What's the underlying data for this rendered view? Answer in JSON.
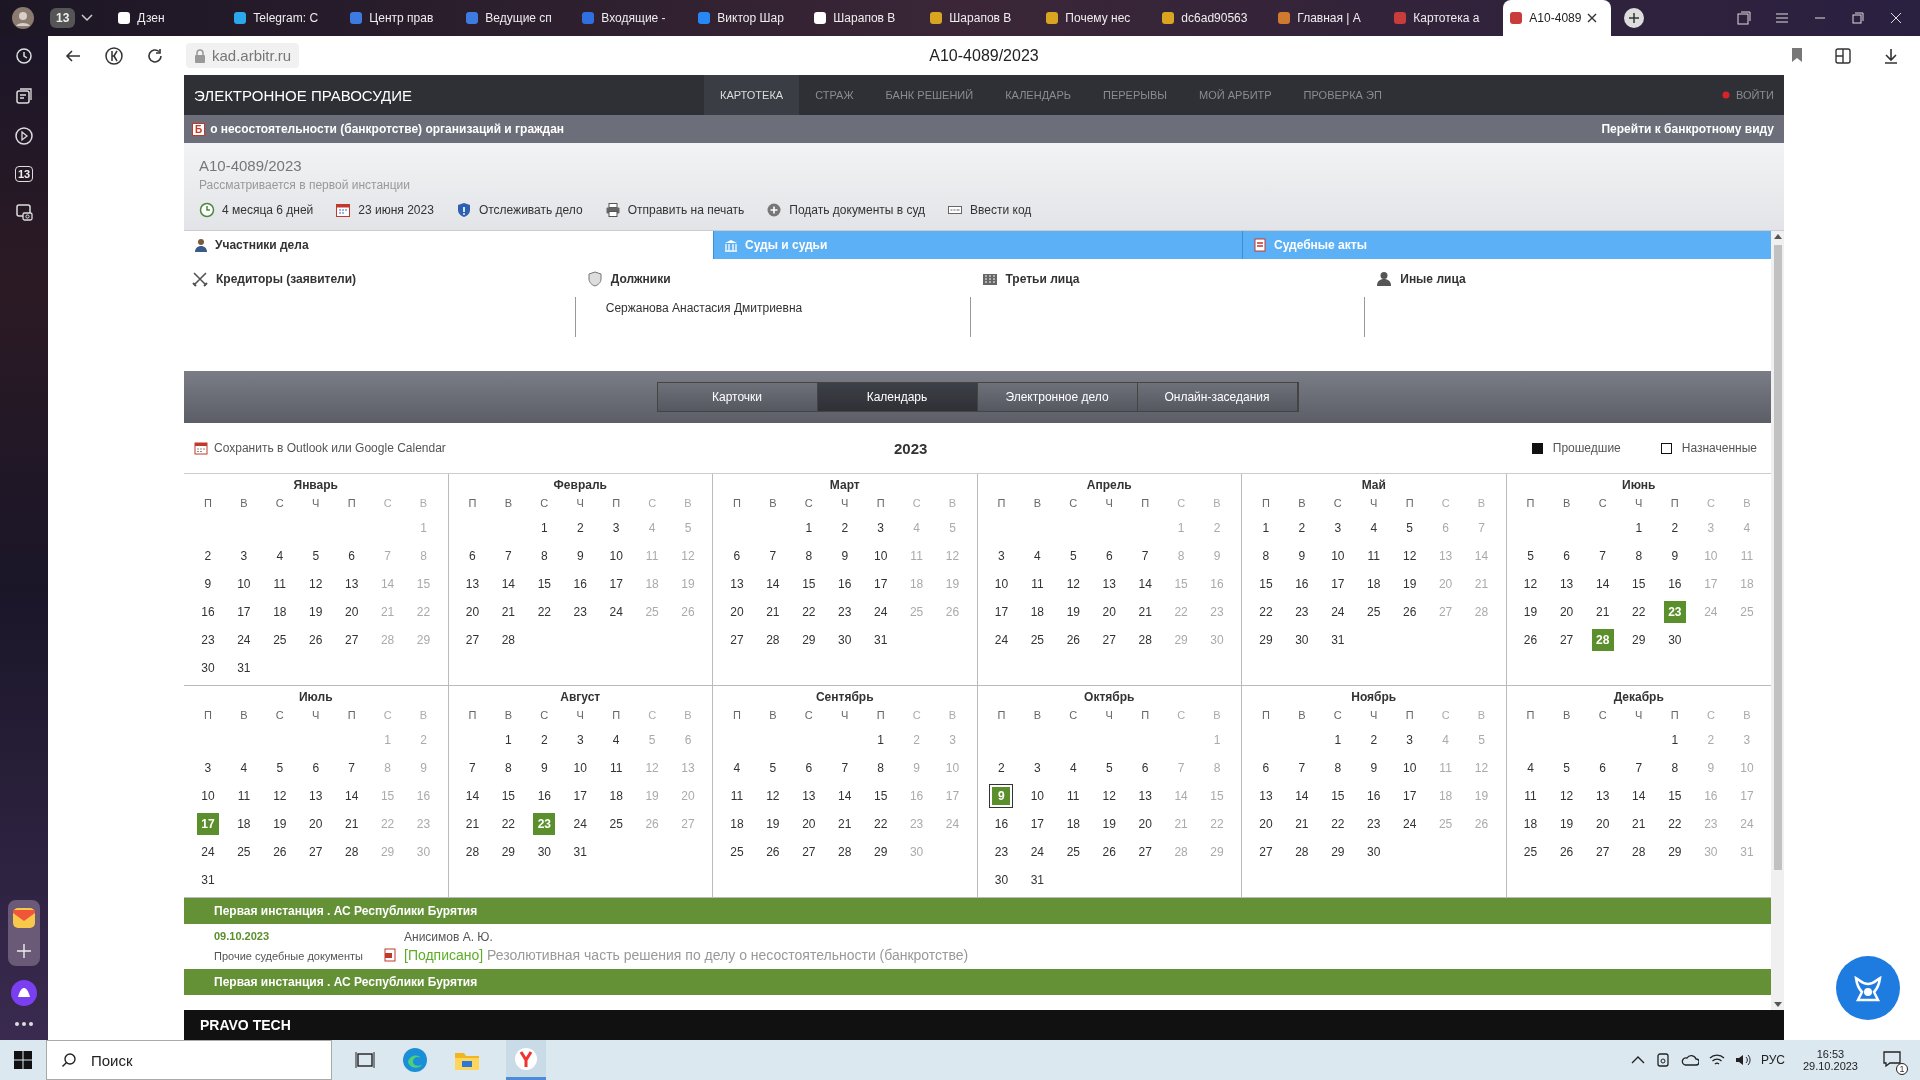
{
  "browser": {
    "tab_count": "13",
    "tabs": [
      {
        "title": "Дзен",
        "selected": false
      },
      {
        "title": "Telegram: С",
        "selected": false
      },
      {
        "title": "Центр прав",
        "selected": false
      },
      {
        "title": "Ведущие сп",
        "selected": false
      },
      {
        "title": "Входящие -",
        "selected": false
      },
      {
        "title": "Виктор Шар",
        "selected": false
      },
      {
        "title": "Шарапов В",
        "selected": false
      },
      {
        "title": "Шарапов В",
        "selected": false
      },
      {
        "title": "Почему нес",
        "selected": false
      },
      {
        "title": "dc6ad90563",
        "selected": false
      },
      {
        "title": "Главная | А",
        "selected": false
      },
      {
        "title": "Картотека а",
        "selected": false
      },
      {
        "title": "A10-4089",
        "selected": true
      }
    ],
    "address": "kad.arbitr.ru",
    "page_title": "A10-4089/2023",
    "sidebar_badge": "13"
  },
  "site": {
    "title": "ЭЛЕКТРОННОЕ ПРАВОСУДИЕ",
    "nav": [
      {
        "label": "КАРТОТЕКА",
        "selected": true
      },
      {
        "label": "СТРАЖ",
        "selected": false
      },
      {
        "label": "БАНК РЕШЕНИЙ",
        "selected": false
      },
      {
        "label": "КАЛЕНДАРЬ",
        "selected": false
      },
      {
        "label": "ПЕРЕРЫВЫ",
        "selected": false
      },
      {
        "label": "МОЙ АРБИТР",
        "selected": false
      },
      {
        "label": "ПРОВЕРКА ЭП",
        "selected": false
      }
    ],
    "login": "ВОЙТИ"
  },
  "bankruptcy_bar": {
    "badge": "Б",
    "text": "о несостоятельности (банкротстве) организаций и граждан",
    "link": "Перейти к банкротному виду"
  },
  "case": {
    "number": "А10-4089/2023",
    "status": "Рассматривается в первой инстанции",
    "info": [
      "4 месяца 6 дней",
      "23 июня 2023",
      "Отслеживать дело",
      "Отправить на печать",
      "Подать документы в суд",
      "Ввести код"
    ]
  },
  "case_tabs": [
    {
      "label": "Участники дела",
      "selected": true
    },
    {
      "label": "Суды и судьи",
      "selected": false
    },
    {
      "label": "Судебные акты",
      "selected": false
    }
  ],
  "participants": [
    {
      "heading": "Кредиторы (заявители)"
    },
    {
      "heading": "Должники",
      "names": [
        "Сержанова Анастасия Дмитриевна"
      ]
    },
    {
      "heading": "Третьи лица"
    },
    {
      "heading": "Иные лица"
    }
  ],
  "view_tabs": [
    {
      "label": "Карточки",
      "selected": false
    },
    {
      "label": "Календарь",
      "selected": true
    },
    {
      "label": "Электронное дело",
      "selected": false
    },
    {
      "label": "Онлайн-заседания",
      "selected": false
    }
  ],
  "calendar": {
    "save_link": "Сохранить в Outlook или Google Calendar",
    "year": "2023",
    "legend": [
      {
        "label": "Прошедшие",
        "kind": "past"
      },
      {
        "label": "Назначенные",
        "kind": "scheduled"
      }
    ],
    "months": [
      {
        "name": "Январь",
        "weekdays": [
          "П",
          "В",
          "С",
          "Ч",
          "П",
          "С",
          "В"
        ],
        "weeks": [
          [
            "1"
          ],
          [
            "2",
            "3",
            "4",
            "5",
            "6",
            "7",
            "8"
          ],
          [
            "9",
            "10",
            "11",
            "12",
            "13",
            "14",
            "15"
          ],
          [
            "16",
            "17",
            "18",
            "19",
            "20",
            "21",
            "22"
          ],
          [
            "23",
            "24",
            "25",
            "26",
            "27",
            "28",
            "29"
          ],
          [
            "30",
            "31"
          ]
        ]
      },
      {
        "name": "Февраль",
        "weekdays": [
          "П",
          "В",
          "С",
          "Ч",
          "П",
          "С",
          "В"
        ],
        "weeks": [
          [
            "1",
            "2",
            "3",
            "4",
            "5"
          ],
          [
            "6",
            "7",
            "8",
            "9",
            "10",
            "11",
            "12"
          ],
          [
            "13",
            "14",
            "15",
            "16",
            "17",
            "18",
            "19"
          ],
          [
            "20",
            "21",
            "22",
            "23",
            "24",
            "25",
            "26"
          ],
          [
            "27",
            "28"
          ]
        ]
      },
      {
        "name": "Март",
        "weekdays": [
          "П",
          "В",
          "С",
          "Ч",
          "П",
          "С",
          "В"
        ],
        "weeks": [
          [
            "1",
            "2",
            "3",
            "4",
            "5"
          ],
          [
            "6",
            "7",
            "8",
            "9",
            "10",
            "11",
            "12"
          ],
          [
            "13",
            "14",
            "15",
            "16",
            "17",
            "18",
            "19"
          ],
          [
            "20",
            "21",
            "22",
            "23",
            "24",
            "25",
            "26"
          ],
          [
            "27",
            "28",
            "29",
            "30",
            "31"
          ]
        ]
      },
      {
        "name": "Апрель",
        "weekdays": [
          "П",
          "В",
          "С",
          "Ч",
          "П",
          "С",
          "В"
        ],
        "weeks": [
          [
            "1",
            "2"
          ],
          [
            "3",
            "4",
            "5",
            "6",
            "7",
            "8",
            "9"
          ],
          [
            "10",
            "11",
            "12",
            "13",
            "14",
            "15",
            "16"
          ],
          [
            "17",
            "18",
            "19",
            "20",
            "21",
            "22",
            "23"
          ],
          [
            "24",
            "25",
            "26",
            "27",
            "28",
            "29",
            "30"
          ]
        ]
      },
      {
        "name": "Май",
        "weekdays": [
          "П",
          "В",
          "С",
          "Ч",
          "П",
          "С",
          "В"
        ],
        "weeks": [
          [
            "1",
            "2",
            "3",
            "4",
            "5",
            "6",
            "7"
          ],
          [
            "8",
            "9",
            "10",
            "11",
            "12",
            "13",
            "14"
          ],
          [
            "15",
            "16",
            "17",
            "18",
            "19",
            "20",
            "21"
          ],
          [
            "22",
            "23",
            "24",
            "25",
            "26",
            "27",
            "28"
          ],
          [
            "29",
            "30",
            "31"
          ]
        ]
      },
      {
        "name": "Июнь",
        "weekdays": [
          "П",
          "В",
          "С",
          "Ч",
          "П",
          "С",
          "В"
        ],
        "weeks": [
          [
            "1",
            "2",
            "3",
            "4"
          ],
          [
            "5",
            "6",
            "7",
            "8",
            "9",
            "10",
            "11"
          ],
          [
            "12",
            "13",
            "14",
            "15",
            "16",
            "17",
            "18"
          ],
          [
            "19",
            "20",
            "21",
            "22",
            {
              "day": "23",
              "kind": "past"
            },
            "24",
            "25"
          ],
          [
            "26",
            "27",
            {
              "day": "28",
              "kind": "past"
            },
            "29",
            "30"
          ]
        ]
      },
      {
        "name": "Июль",
        "weekdays": [
          "П",
          "В",
          "С",
          "Ч",
          "П",
          "С",
          "В"
        ],
        "weeks": [
          [
            "1",
            "2"
          ],
          [
            "3",
            "4",
            "5",
            "6",
            "7",
            "8",
            "9"
          ],
          [
            "10",
            "11",
            "12",
            "13",
            "14",
            "15",
            "16"
          ],
          [
            {
              "day": "17",
              "kind": "past"
            },
            "18",
            "19",
            "20",
            "21",
            "22",
            "23"
          ],
          [
            "24",
            "25",
            "26",
            "27",
            "28",
            "29",
            "30"
          ],
          [
            "31"
          ]
        ]
      },
      {
        "name": "Август",
        "weekdays": [
          "П",
          "В",
          "С",
          "Ч",
          "П",
          "С",
          "В"
        ],
        "weeks": [
          [
            "1",
            "2",
            "3",
            "4",
            "5",
            "6"
          ],
          [
            "7",
            "8",
            "9",
            "10",
            "11",
            "12",
            "13"
          ],
          [
            "14",
            "15",
            "16",
            "17",
            "18",
            "19",
            "20"
          ],
          [
            "21",
            "22",
            {
              "day": "23",
              "kind": "past"
            },
            "24",
            "25",
            "26",
            "27"
          ],
          [
            "28",
            "29",
            "30",
            "31"
          ]
        ]
      },
      {
        "name": "Сентябрь",
        "weekdays": [
          "П",
          "В",
          "С",
          "Ч",
          "П",
          "С",
          "В"
        ],
        "weeks": [
          [
            "1",
            "2",
            "3"
          ],
          [
            "4",
            "5",
            "6",
            "7",
            "8",
            "9",
            "10"
          ],
          [
            "11",
            "12",
            "13",
            "14",
            "15",
            "16",
            "17"
          ],
          [
            "18",
            "19",
            "20",
            "21",
            "22",
            "23",
            "24"
          ],
          [
            "25",
            "26",
            "27",
            "28",
            "29",
            "30"
          ]
        ]
      },
      {
        "name": "Октябрь",
        "weekdays": [
          "П",
          "В",
          "С",
          "Ч",
          "П",
          "С",
          "В"
        ],
        "weeks": [
          [
            "1"
          ],
          [
            "2",
            "3",
            "4",
            "5",
            "6",
            "7",
            "8"
          ],
          [
            {
              "day": "9",
              "kind": "current"
            },
            "10",
            "11",
            "12",
            "13",
            "14",
            "15"
          ],
          [
            "16",
            "17",
            "18",
            "19",
            "20",
            "21",
            "22"
          ],
          [
            "23",
            "24",
            "25",
            "26",
            "27",
            "28",
            "29"
          ],
          [
            "30",
            "31"
          ]
        ]
      },
      {
        "name": "Ноябрь",
        "weekdays": [
          "П",
          "В",
          "С",
          "Ч",
          "П",
          "С",
          "В"
        ],
        "weeks": [
          [
            "1",
            "2",
            "3",
            "4",
            "5"
          ],
          [
            "6",
            "7",
            "8",
            "9",
            "10",
            "11",
            "12"
          ],
          [
            "13",
            "14",
            "15",
            "16",
            "17",
            "18",
            "19"
          ],
          [
            "20",
            "21",
            "22",
            "23",
            "24",
            "25",
            "26"
          ],
          [
            "27",
            "28",
            "29",
            "30"
          ]
        ]
      },
      {
        "name": "Декабрь",
        "weekdays": [
          "П",
          "В",
          "С",
          "Ч",
          "П",
          "С",
          "В"
        ],
        "weeks": [
          [
            "1",
            "2",
            "3"
          ],
          [
            "4",
            "5",
            "6",
            "7",
            "8",
            "9",
            "10"
          ],
          [
            "11",
            "12",
            "13",
            "14",
            "15",
            "16",
            "17"
          ],
          [
            "18",
            "19",
            "20",
            "21",
            "22",
            "23",
            "24"
          ],
          [
            "25",
            "26",
            "27",
            "28",
            "29",
            "30",
            "31"
          ]
        ]
      }
    ]
  },
  "events": [
    {
      "header": "Первая инстанция . АС Республики Бурятия",
      "items": [
        {
          "date": "09.10.2023",
          "type": "Прочие судебные документы",
          "judge": "Анисимов А. Ю.",
          "status": "[Подписано]",
          "title": "Резолютивная часть решения по делу о несостоятельности (банкротстве)"
        }
      ]
    },
    {
      "header": "Первая инстанция . АС Республики Бурятия"
    }
  ],
  "footer": {
    "brand": "PRAVO TECH"
  },
  "taskbar": {
    "search": "Поиск",
    "language": "РУС",
    "time": "16:53",
    "date": "29.10.2023",
    "notifications": "1"
  }
}
